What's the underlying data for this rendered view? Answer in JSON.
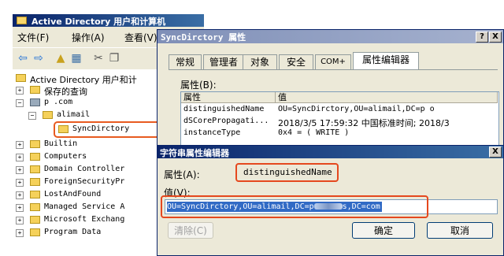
{
  "mmc": {
    "title": "Active Directory 用户和计算机",
    "menu": [
      "文件(F)",
      "操作(A)",
      "查看(V)"
    ],
    "tree": {
      "root": "Active Directory 用户和计",
      "saved": "保存的查询",
      "domain": "p      .com",
      "ou": "alimail",
      "selected": "SyncDirctory",
      "children": [
        "Builtin",
        "Computers",
        "Domain Controller",
        "ForeignSecurityPr",
        "LostAndFound",
        "Managed Service A",
        "Microsoft Exchang",
        "Program Data"
      ]
    }
  },
  "props": {
    "title": "SyncDirctory 属性",
    "help": "?",
    "close": "X",
    "tabs": [
      "常规",
      "管理者",
      "对象",
      "安全",
      "COM+",
      "属性编辑器"
    ],
    "attrs_label": "属性(B):",
    "col_attr": "属性",
    "col_value": "值",
    "rows": [
      {
        "attr": "distinguishedName",
        "value": "OU=SyncDirctory,OU=alimail,DC=p     o"
      },
      {
        "attr": "dSCorePropagati...",
        "value": "2018/3/5 17:59:32 中国标准时间; 2018/3"
      },
      {
        "attr": "instanceType",
        "value": "0x4 = ( WRITE )"
      }
    ]
  },
  "editor": {
    "title": "字符串属性编辑器",
    "close": "X",
    "attr_label": "属性(A):",
    "attr_name": "distinguishedName",
    "value_label": "值(V):",
    "value_prefix": "OU=SyncDirctory,OU=alimail,DC=p",
    "value_suffix": "s,DC=com",
    "clear": "清除(C)",
    "ok": "确定",
    "cancel": "取消"
  },
  "colors": {
    "highlight": "#e5481e",
    "selection": "#316ac5"
  }
}
